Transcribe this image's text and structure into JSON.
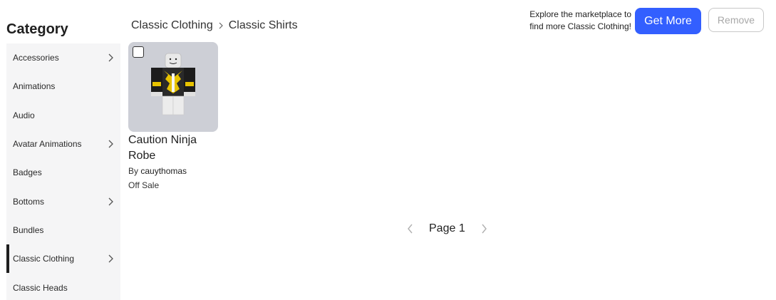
{
  "sidebar": {
    "title": "Category",
    "items": [
      {
        "label": "Accessories",
        "has_children": true,
        "active": false
      },
      {
        "label": "Animations",
        "has_children": false,
        "active": false
      },
      {
        "label": "Audio",
        "has_children": false,
        "active": false
      },
      {
        "label": "Avatar Animations",
        "has_children": true,
        "active": false
      },
      {
        "label": "Badges",
        "has_children": false,
        "active": false
      },
      {
        "label": "Bottoms",
        "has_children": true,
        "active": false
      },
      {
        "label": "Bundles",
        "has_children": false,
        "active": false
      },
      {
        "label": "Classic Clothing",
        "has_children": true,
        "active": true
      },
      {
        "label": "Classic Heads",
        "has_children": false,
        "active": false
      }
    ]
  },
  "breadcrumb": {
    "items": [
      "Classic Clothing",
      "Classic Shirts"
    ]
  },
  "header": {
    "promo_line1": "Explore the marketplace to",
    "promo_line2": "find more Classic Clothing!",
    "get_more_label": "Get More",
    "remove_label": "Remove"
  },
  "items": [
    {
      "name": "Caution Ninja Robe",
      "by_label": "By",
      "creator": "cauythomas",
      "status": "Off Sale"
    }
  ],
  "pagination": {
    "label": "Page 1"
  },
  "colors": {
    "accent": "#335fff",
    "sidebar_bg": "#f5f5f6",
    "thumb_bg": "#cdcfd6"
  }
}
